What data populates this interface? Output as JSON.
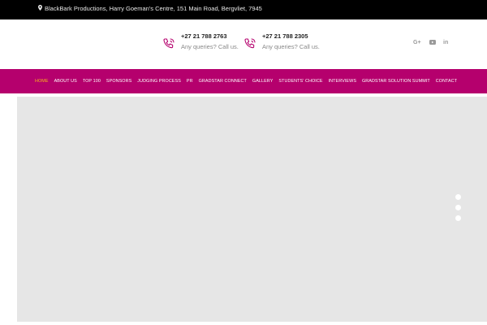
{
  "topbar": {
    "address": "BlackBark Productions, Harry Goeman's Centre, 151 Main Road, Bergvliet, 7945",
    "pin_icon": "map-marker-icon"
  },
  "header": {
    "contacts": [
      {
        "number": "+27 21 788 2763",
        "caption": "Any queries? Call us.",
        "icon": "phone-icon"
      },
      {
        "number": "+27 21 788 2305",
        "caption": "Any queries? Call us.",
        "icon": "phone-icon"
      }
    ],
    "social": {
      "google": "G+",
      "youtube": "youtube-icon",
      "linkedin": "in"
    }
  },
  "nav": {
    "items": [
      "HOME",
      "ABOUT US",
      "TOP 100",
      "SPONSORS",
      "JUDGING PROCESS",
      "PR",
      "GRADSTAR CONNECT",
      "GALLERY",
      "STUDENTS' CHOICE",
      "INTERVIEWS",
      "GRADSTAR SOLUTION SUMMIT",
      "CONTACT"
    ],
    "active_index": 0
  },
  "slider": {
    "slide_count": 3
  },
  "colors": {
    "nav_bg": "#b5006d",
    "nav_active": "#f6b21b",
    "topbar_bg": "#000000",
    "slider_bg": "#e6e6e6",
    "icon_accent": "#b5006d"
  }
}
